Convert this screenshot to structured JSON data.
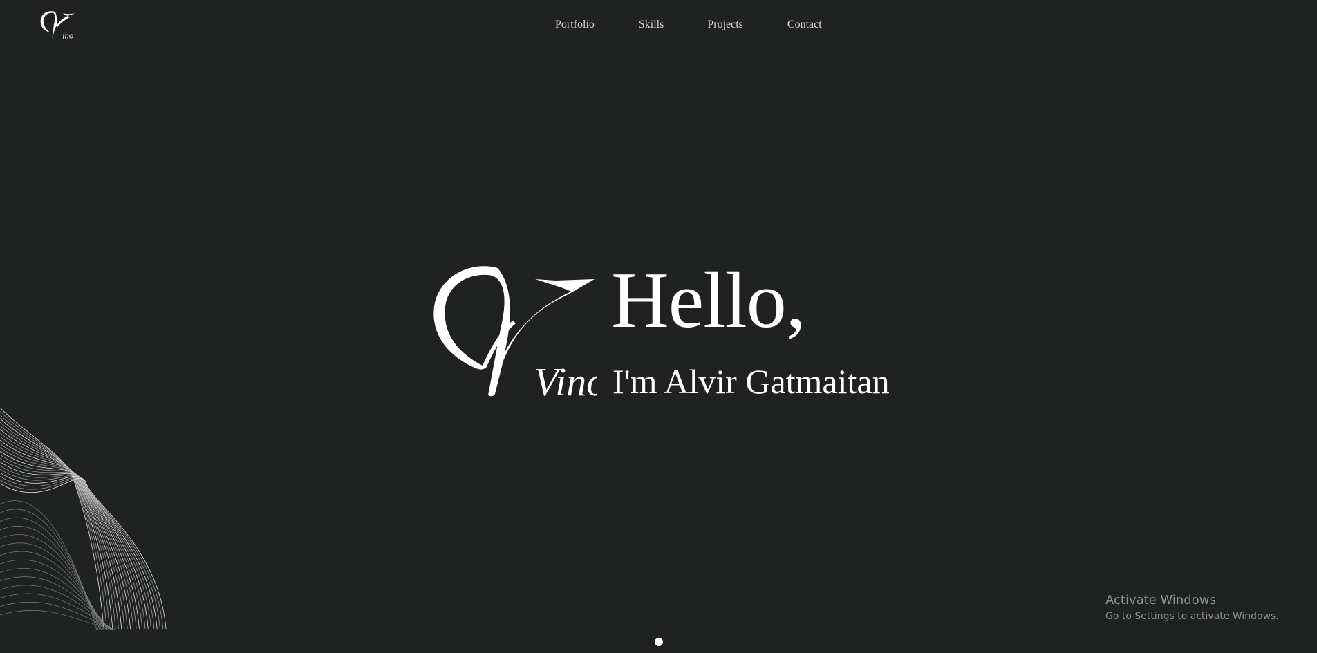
{
  "header": {
    "logo_icon": "vino-monogram-icon",
    "nav": [
      {
        "label": "Portfolio"
      },
      {
        "label": "Skills"
      },
      {
        "label": "Projects"
      },
      {
        "label": "Contact"
      }
    ]
  },
  "hero": {
    "logo_icon": "vino-monogram-icon",
    "logo_text": "Vino",
    "title": "Hello,",
    "subtitle": "I'm Alvir Gatmaitan"
  },
  "decoration": {
    "icon": "wave-lines-graphic"
  },
  "scroll_indicator": {
    "icon": "dot-icon"
  },
  "watermark": {
    "title": "Activate Windows",
    "subtitle": "Go to Settings to activate Windows."
  },
  "colors": {
    "background": "#202221",
    "text": "#ffffff",
    "nav_text": "#d6d6d6",
    "watermark_text": "#8f9190"
  }
}
